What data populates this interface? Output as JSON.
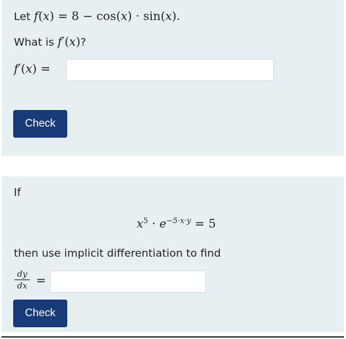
{
  "q1": {
    "intro": "Let",
    "question_prefix": "What is",
    "check_label": "Check",
    "answer_value": "",
    "math": {
      "f": "f",
      "x": "x",
      "open": "(",
      "close": ")",
      "eq_rest": " = 8 − cos(",
      "mid": ") · sin(",
      "end": ").",
      "fprime": "f",
      "prime": "′",
      "question_mark": "?",
      "eq": "="
    }
  },
  "q2": {
    "if_label": "If",
    "instruction": "then use implicit differentiation to find",
    "check_label": "Check",
    "answer_value": "",
    "equation": {
      "base": "x",
      "exp1": "5",
      "dot": "·",
      "e": "e",
      "exp2": "−5·x·y",
      "rhs": "= 5"
    },
    "derivative": {
      "num": "dy",
      "den": "dx",
      "eq": "="
    }
  }
}
